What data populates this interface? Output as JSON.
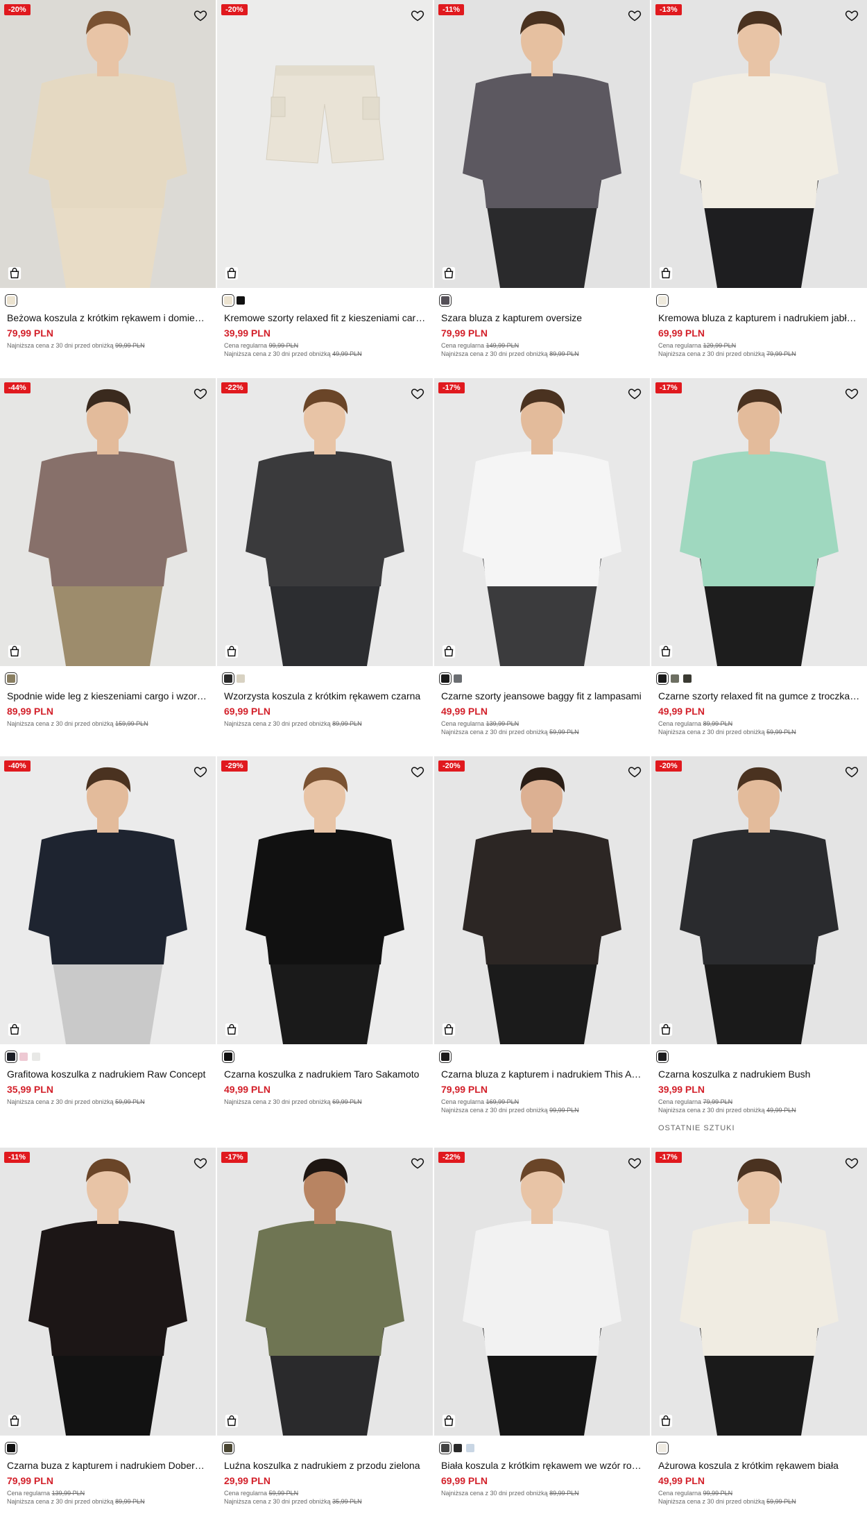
{
  "icons": {
    "wishlist": "heart-outline-icon",
    "add_to_bag": "shopping-bag-icon"
  },
  "colors": {
    "sale_red": "#e0191e",
    "price_red": "#d3202a"
  },
  "products": [
    {
      "badge": "-20%",
      "name": "Beżowa koszula z krótkim rękawem i domie…",
      "price": "79,99 PLN",
      "regular_label": "",
      "regular_price": "",
      "lowest_label": "Najniższa cena z 30 dni przed obniżką",
      "lowest_price": "99,99 PLN",
      "extra": "",
      "swatches": [
        "#ece3d0"
      ],
      "bg": "#dcdad5",
      "top": "#e5d9c2",
      "bottom": "#e8dcc6",
      "skin": "#e8c4a6",
      "hair": "#7a5232",
      "kind": "person"
    },
    {
      "badge": "-20%",
      "name": "Kremowe szorty relaxed fit z kieszeniami car…",
      "price": "39,99 PLN",
      "regular_label": "Cena regularna",
      "regular_price": "99,99 PLN",
      "lowest_label": "Najniższa cena z 30 dni przed obniżką",
      "lowest_price": "49,99 PLN",
      "extra": "",
      "swatches": [
        "#ece3d0",
        "#111111"
      ],
      "bg": "#ececeb",
      "top": "#e9e3d6",
      "bottom": "#e9e3d6",
      "skin": "#e8c4a6",
      "hair": "#7a5232",
      "kind": "shorts"
    },
    {
      "badge": "-11%",
      "name": "Szara bluza z kapturem oversize",
      "price": "79,99 PLN",
      "regular_label": "Cena regularna",
      "regular_price": "149,99 PLN",
      "lowest_label": "Najniższa cena z 30 dni przed obniżką",
      "lowest_price": "89,99 PLN",
      "extra": "",
      "swatches": [
        "#555058"
      ],
      "bg": "#e2e2e2",
      "top": "#5c5860",
      "bottom": "#2a2a2c",
      "skin": "#e6c0a0",
      "hair": "#4a3220",
      "kind": "person"
    },
    {
      "badge": "-13%",
      "name": "Kremowa bluza z kapturem i nadrukiem jabł…",
      "price": "69,99 PLN",
      "regular_label": "Cena regularna",
      "regular_price": "129,99 PLN",
      "lowest_label": "Najniższa cena z 30 dni przed obniżką",
      "lowest_price": "79,99 PLN",
      "extra": "",
      "swatches": [
        "#efeadd"
      ],
      "bg": "#e4e4e4",
      "top": "#f1ede3",
      "bottom": "#1e1e20",
      "skin": "#e8c4a6",
      "hair": "#4a3220",
      "kind": "person"
    },
    {
      "badge": "-44%",
      "name": "Spodnie wide leg z kieszeniami cargo i wzor…",
      "price": "89,99 PLN",
      "regular_label": "",
      "regular_price": "",
      "lowest_label": "Najniższa cena z 30 dni przed obniżką",
      "lowest_price": "159,99 PLN",
      "extra": "",
      "swatches": [
        "#8a7f62"
      ],
      "bg": "#e6e6e4",
      "top": "#87706a",
      "bottom": "#9d8c6c",
      "skin": "#e3bb9b",
      "hair": "#3a2a1e",
      "kind": "person"
    },
    {
      "badge": "-22%",
      "name": "Wzorzysta koszula z krótkim rękawem czarna",
      "price": "69,99 PLN",
      "regular_label": "",
      "regular_price": "",
      "lowest_label": "Najniższa cena z 30 dni przed obniżką",
      "lowest_price": "89,99 PLN",
      "extra": "",
      "swatches": [
        "#2a2a2a",
        "#d8d2c2"
      ],
      "bg": "#e9e9e9",
      "top": "#3a3a3c",
      "bottom": "#2c2d30",
      "skin": "#e8c4a6",
      "hair": "#6a4528",
      "kind": "person"
    },
    {
      "badge": "-17%",
      "name": "Czarne szorty jeansowe baggy fit z lampasami",
      "price": "49,99 PLN",
      "regular_label": "Cena regularna",
      "regular_price": "139,99 PLN",
      "lowest_label": "Najniższa cena z 30 dni przed obniżką",
      "lowest_price": "59,99 PLN",
      "extra": "",
      "swatches": [
        "#1a1a1a",
        "#6b6e72"
      ],
      "bg": "#e8e8e8",
      "top": "#f5f5f5",
      "bottom": "#3b3b3d",
      "skin": "#e3bb9b",
      "hair": "#4a3220",
      "kind": "person"
    },
    {
      "badge": "-17%",
      "name": "Czarne szorty relaxed fit na gumce z troczka…",
      "price": "49,99 PLN",
      "regular_label": "Cena regularna",
      "regular_price": "89,99 PLN",
      "lowest_label": "Najniższa cena z 30 dni przed obniżką",
      "lowest_price": "59,99 PLN",
      "extra": "",
      "swatches": [
        "#1a1a1a",
        "#6d6f62",
        "#3a3a32"
      ],
      "bg": "#e8e8e8",
      "top": "#9fd8bf",
      "bottom": "#1d1d1d",
      "skin": "#e3bb9b",
      "hair": "#4a3220",
      "kind": "person"
    },
    {
      "badge": "-40%",
      "name": "Grafitowa koszulka z nadrukiem Raw Concept",
      "price": "35,99 PLN",
      "regular_label": "",
      "regular_price": "",
      "lowest_label": "Najniższa cena z 30 dni przed obniżką",
      "lowest_price": "59,99 PLN",
      "extra": "",
      "swatches": [
        "#1c1f26",
        "#eec9d3",
        "#e8e8e6"
      ],
      "bg": "#ebebeb",
      "top": "#1e2430",
      "bottom": "#c9c9c9",
      "skin": "#e3bb9b",
      "hair": "#4a3220",
      "kind": "person"
    },
    {
      "badge": "-29%",
      "name": "Czarna koszulka z nadrukiem Taro Sakamoto",
      "price": "49,99 PLN",
      "regular_label": "",
      "regular_price": "",
      "lowest_label": "Najniższa cena z 30 dni przed obniżką",
      "lowest_price": "69,99 PLN",
      "extra": "",
      "swatches": [
        "#111111"
      ],
      "bg": "#ececec",
      "top": "#111111",
      "bottom": "#1a1a1a",
      "skin": "#e8c4a6",
      "hair": "#7a5232",
      "kind": "person"
    },
    {
      "badge": "-20%",
      "name": "Czarna bluza z kapturem i nadrukiem This A…",
      "price": "79,99 PLN",
      "regular_label": "Cena regularna",
      "regular_price": "169,99 PLN",
      "lowest_label": "Najniższa cena z 30 dni przed obniżką",
      "lowest_price": "99,99 PLN",
      "extra": "",
      "swatches": [
        "#1c1a1a"
      ],
      "bg": "#e6e6e6",
      "top": "#2c2624",
      "bottom": "#1b1b1b",
      "skin": "#dcb092",
      "hair": "#2a1e16",
      "kind": "person"
    },
    {
      "badge": "-20%",
      "name": "Czarna koszulka z nadrukiem Bush",
      "price": "39,99 PLN",
      "regular_label": "Cena regularna",
      "regular_price": "79,99 PLN",
      "lowest_label": "Najniższa cena z 30 dni przed obniżką",
      "lowest_price": "49,99 PLN",
      "extra": "OSTATNIE SZTUKI",
      "swatches": [
        "#1c1c1e"
      ],
      "bg": "#e4e4e4",
      "top": "#2a2b2e",
      "bottom": "#1a1a1a",
      "skin": "#e3bb9b",
      "hair": "#4a3220",
      "kind": "person"
    },
    {
      "badge": "-11%",
      "name": "Czarna buza z kapturem i nadrukiem Dober…",
      "price": "79,99 PLN",
      "regular_label": "Cena regularna",
      "regular_price": "139,99 PLN",
      "lowest_label": "Najniższa cena z 30 dni przed obniżką",
      "lowest_price": "89,99 PLN",
      "extra": "",
      "swatches": [
        "#111111"
      ],
      "bg": "#e6e6e6",
      "top": "#1c1616",
      "bottom": "#121212",
      "skin": "#e8c4a6",
      "hair": "#6a4528",
      "kind": "person"
    },
    {
      "badge": "-17%",
      "name": "Luźna koszulka z nadrukiem z przodu zielona",
      "price": "29,99 PLN",
      "regular_label": "Cena regularna",
      "regular_price": "59,99 PLN",
      "lowest_label": "Najniższa cena z 30 dni przed obniżką",
      "lowest_price": "35,99 PLN",
      "extra": "",
      "swatches": [
        "#4a4632"
      ],
      "bg": "#e6e6e6",
      "top": "#6f7553",
      "bottom": "#2a2a2c",
      "skin": "#b88462",
      "hair": "#1e1612",
      "kind": "person"
    },
    {
      "badge": "-22%",
      "name": "Biała koszula z krótkim rękawem we wzór ro…",
      "price": "69,99 PLN",
      "regular_label": "",
      "regular_price": "",
      "lowest_label": "Najniższa cena z 30 dni przed obniżką",
      "lowest_price": "89,99 PLN",
      "extra": "",
      "swatches": [
        "#444444",
        "#2a2a2a",
        "#c9d6e4"
      ],
      "bg": "#e4e4e4",
      "top": "#f2f2f2",
      "bottom": "#151515",
      "skin": "#e8c4a6",
      "hair": "#6a4528",
      "kind": "person"
    },
    {
      "badge": "-17%",
      "name": "Ażurowa koszula z krótkim rękawem biała",
      "price": "49,99 PLN",
      "regular_label": "Cena regularna",
      "regular_price": "99,99 PLN",
      "lowest_label": "Najniższa cena z 30 dni przed obniżką",
      "lowest_price": "59,99 PLN",
      "extra": "",
      "swatches": [
        "#efebe2"
      ],
      "bg": "#e6e6e6",
      "top": "#f0ece2",
      "bottom": "#1a1a1a",
      "skin": "#e8c4a6",
      "hair": "#4a3220",
      "kind": "person"
    }
  ]
}
